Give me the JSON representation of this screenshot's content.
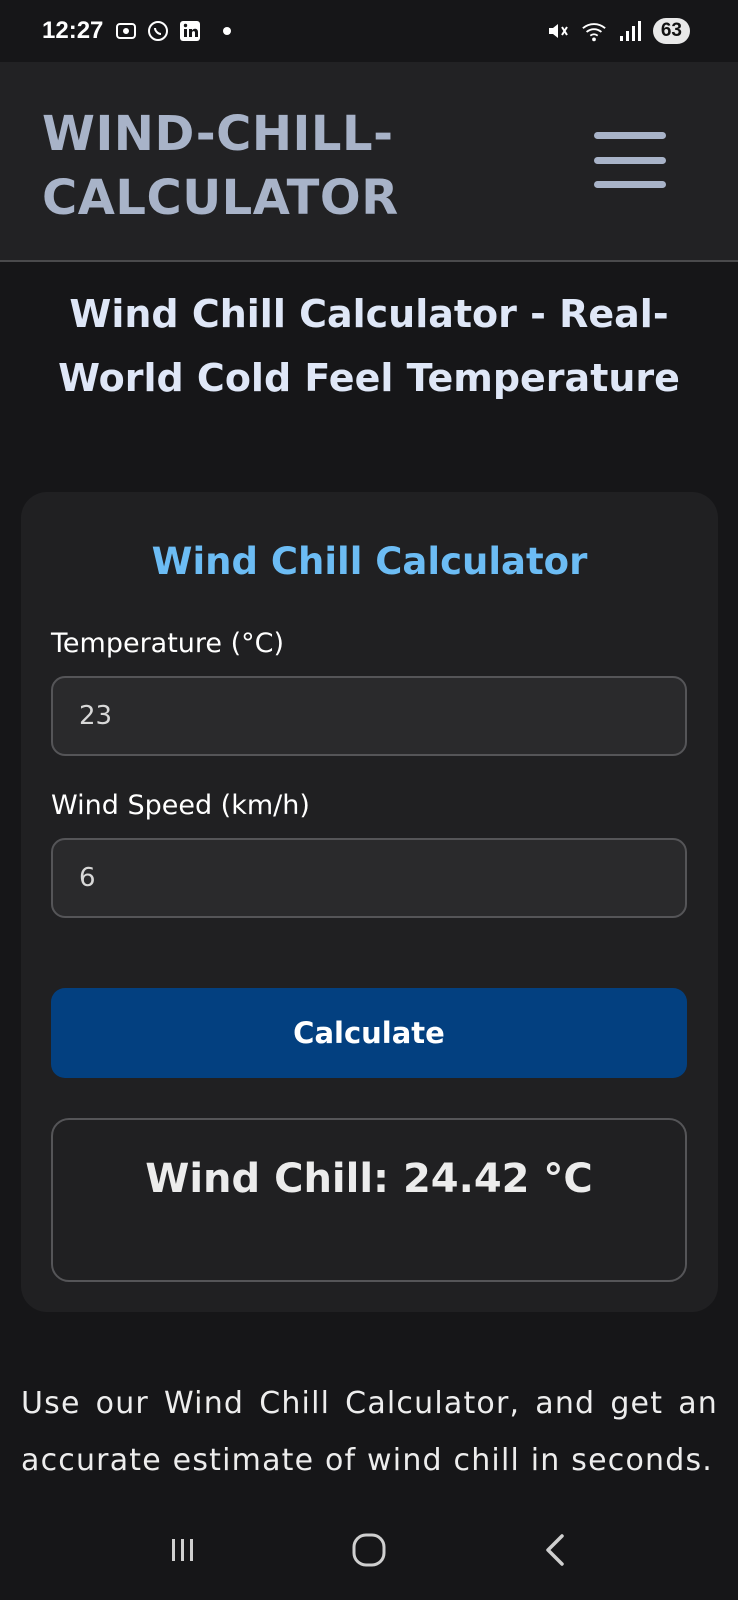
{
  "status_bar": {
    "time": "12:27",
    "left_icons": [
      "screen-record-icon",
      "whatsapp-icon",
      "linkedin-icon"
    ],
    "right_icons": [
      "mute-icon",
      "wifi-icon",
      "signal-icon"
    ],
    "battery": "63"
  },
  "header": {
    "brand": "WIND-CHILL-\nCALCULATOR",
    "menu_icon": "hamburger-menu-icon"
  },
  "page": {
    "title": "Wind Chill Calculator - Real-World Cold Feel Temperature"
  },
  "calculator": {
    "title": "Wind Chill Calculator",
    "temperature_label": "Temperature (°C)",
    "temperature_value": "23",
    "wind_label": "Wind Speed (km/h)",
    "wind_value": "6",
    "button_label": "Calculate",
    "result": "Wind Chill: 24.42 °C"
  },
  "description": "Use our Wind Chill Calculator, and get an accurate estimate of wind chill in seconds.",
  "nav_bar": {
    "icons": [
      "recent-apps-icon",
      "home-icon",
      "back-icon"
    ]
  },
  "colors": {
    "background": "#161618",
    "accent": "#6cbcf4",
    "button": "#034080",
    "brand": "#a8b3c8"
  }
}
